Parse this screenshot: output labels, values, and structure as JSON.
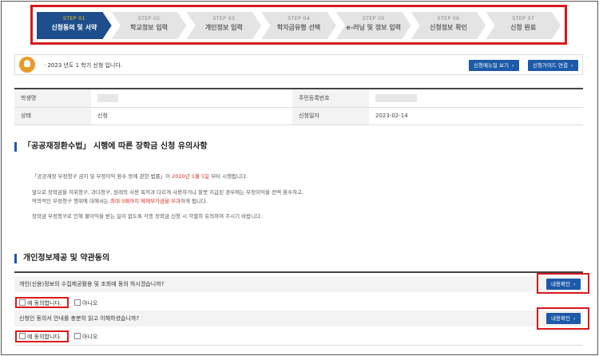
{
  "steps": [
    {
      "num": "STEP 01",
      "label": "신청동의 및 서약"
    },
    {
      "num": "STEP 02",
      "label": "학교정보 입력"
    },
    {
      "num": "STEP 03",
      "label": "개인정보 입력"
    },
    {
      "num": "STEP 04",
      "label": "학자금유형 선택"
    },
    {
      "num": "STEP 05",
      "label": "e-러닝 및 정보 입력"
    },
    {
      "num": "STEP 06",
      "label": "신청정보 확인"
    },
    {
      "num": "STEP 07",
      "label": "신청 완료"
    }
  ],
  "notice": {
    "text": "· 2023 년도 1 학기 신청 입니다.",
    "menu_button": "신청메뉴얼 보기",
    "guide_button": "신청가이드 연결"
  },
  "info": {
    "student_name_label": "학생명",
    "rrn_label": "주민등록번호",
    "status_label": "상태",
    "status_value": "신청",
    "date_label": "신청일자",
    "date_value": "2023-02-14"
  },
  "section1": {
    "title": "「공공재정환수법」 시행에 따른 장학금 신청 유의사항",
    "line1_a": "「공공재정 부정청구 금지 및 부정이익 환수 등에 관한 법률」이 ",
    "line1_red": "2020년 1월 1일",
    "line1_b": " 부터 시행됩니다.",
    "line2": "앞으로 장학금을 허위청구, 과다청구, 원래의 사용 목적과 다르게 사용하거나 잘못 지급된 경우에는 부정이익을 전액 환수하고,",
    "line3_a": "악의적인 부정청구 행위에 대해서는 ",
    "line3_red": "최대 5배까지 제재부가금을 부과",
    "line3_b": "하게 됩니다.",
    "line4": "장학금 부정청구로 인해 불이익을 받는 일이 없도록 각종 장학금 신청 시 각별히 유의하여 주시기 바랍니다."
  },
  "section2": {
    "title": "개인정보제공 및 약관동의",
    "q1": "개인(신용)정보의 수집제공활용 및 조회에 동의 하시겠습니까?",
    "q2": "신청인 동의서 안내를 충분히 읽고 이해하셨습니까?",
    "detail_button": "내용확인",
    "yes": "예 동의합니다.",
    "no": "아니오"
  },
  "colors": {
    "accent": "#1d5aa8",
    "step_active": "#1e4f8c",
    "highlight": "#d7191d"
  }
}
